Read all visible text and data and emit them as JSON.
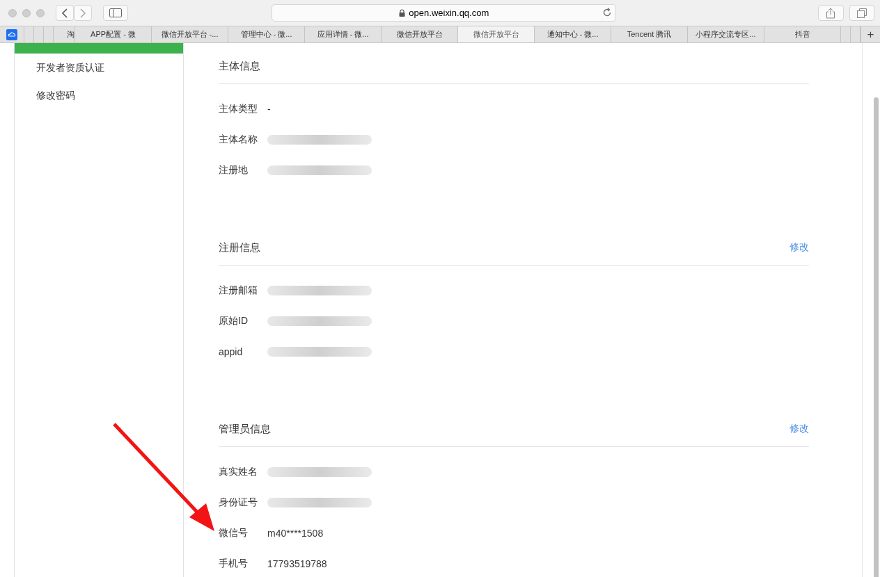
{
  "browser": {
    "address": "open.weixin.qq.com",
    "tabs": [
      {
        "kind": "pinned",
        "selected": false
      },
      {
        "kind": "blank",
        "selected": false
      },
      {
        "kind": "blank",
        "selected": false
      },
      {
        "kind": "blank",
        "selected": false
      },
      {
        "kind": "tab",
        "label": "淘",
        "selected": false
      },
      {
        "kind": "tab",
        "label": "APP配置 - 微",
        "selected": false
      },
      {
        "kind": "tab",
        "label": "微信开放平台 -...",
        "selected": false
      },
      {
        "kind": "tab",
        "label": "管理中心 - 微...",
        "selected": false
      },
      {
        "kind": "tab",
        "label": "应用详情 - 微...",
        "selected": false
      },
      {
        "kind": "tab",
        "label": "微信开放平台",
        "selected": false
      },
      {
        "kind": "tab",
        "label": "微信开放平台",
        "selected": true
      },
      {
        "kind": "tab",
        "label": "通知中心 - 微...",
        "selected": false
      },
      {
        "kind": "tab",
        "label": "Tencent 腾讯",
        "selected": false
      },
      {
        "kind": "tab",
        "label": "小程序交流专区...",
        "selected": false
      },
      {
        "kind": "tab",
        "label": "抖音",
        "selected": false
      },
      {
        "kind": "blank",
        "selected": false
      },
      {
        "kind": "blank",
        "selected": false
      }
    ],
    "new_tab": "+"
  },
  "sidebar": {
    "items": [
      {
        "label": "开发者资质认证"
      },
      {
        "label": "修改密码"
      }
    ]
  },
  "sections": [
    {
      "title": "主体信息",
      "rows": [
        {
          "label": "主体类型",
          "value": "-"
        },
        {
          "label": "主体名称",
          "redacted": true
        },
        {
          "label": "注册地",
          "redacted": true
        }
      ]
    },
    {
      "title": "注册信息",
      "action": "修改",
      "rows": [
        {
          "label": "注册邮箱",
          "redacted": true
        },
        {
          "label": "原始ID",
          "redacted": true
        },
        {
          "label": "appid",
          "redacted": true
        }
      ]
    },
    {
      "title": "管理员信息",
      "action": "修改",
      "rows": [
        {
          "label": "真实姓名",
          "redacted": true
        },
        {
          "label": "身份证号",
          "redacted": true
        },
        {
          "label": "微信号",
          "value": "m40****1508"
        },
        {
          "label": "手机号",
          "value": "17793519788"
        }
      ]
    }
  ]
}
